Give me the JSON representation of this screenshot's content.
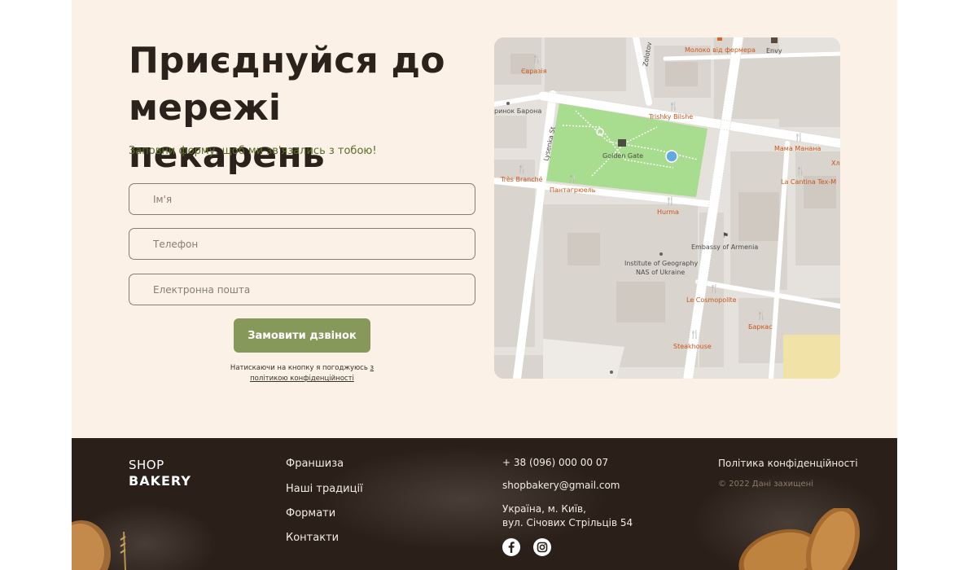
{
  "join": {
    "heading": "Приєднуйся до мережі пекарень",
    "subtitle": "Заповни форму, щоб ми зв'язались з тобою!",
    "fields": {
      "name_placeholder": "Ім'я",
      "phone_placeholder": "Телефон",
      "email_placeholder": "Електронна пошта"
    },
    "submit_label": "Замовити дзвінок",
    "consent_prefix": "Натискаючи на кнопку я погоджуюсь",
    "consent_link": "з політикою конфіденційності"
  },
  "map": {
    "streets": [
      "Zolotov",
      "Lysenka St"
    ],
    "places": [
      {
        "name": "Молоко від фермера",
        "type": "food"
      },
      {
        "name": "Envy",
        "type": "shop"
      },
      {
        "name": "Євразія",
        "type": "food"
      },
      {
        "name": "ринок Барона",
        "type": "place"
      },
      {
        "name": "Trishky Bilshe",
        "type": "food"
      },
      {
        "name": "Golden Gate",
        "type": "landmark"
      },
      {
        "name": "Мама Манана",
        "type": "food"
      },
      {
        "name": "Хл",
        "type": "food"
      },
      {
        "name": "Très Branché",
        "type": "food"
      },
      {
        "name": "Пантагрюель",
        "type": "food"
      },
      {
        "name": "La Cantina Tex-M",
        "type": "food"
      },
      {
        "name": "Hurma",
        "type": "food"
      },
      {
        "name": "Embassy of Armenia",
        "type": "embassy"
      },
      {
        "name": "Institute of Geography",
        "type": "place"
      },
      {
        "name": "NAS of Ukraine",
        "type": "place"
      },
      {
        "name": "Le Cosmopolite",
        "type": "food"
      },
      {
        "name": "Баркас",
        "type": "food"
      },
      {
        "name": "Steakhouse",
        "type": "food"
      }
    ]
  },
  "footer": {
    "logo_line1": "SHOP",
    "logo_line2": "BAKERY",
    "nav": [
      "Франшиза",
      "Наші традиції",
      "Формати",
      "Контакти"
    ],
    "phone": "+ 38 (096) 000 00 07",
    "email": "shopbakery@gmail.com",
    "address_line1": "Україна, м. Київ,",
    "address_line2": "вул. Січових Стрільців 54",
    "social": [
      "facebook-icon",
      "instagram-icon"
    ],
    "privacy": "Політика конфіденційності",
    "copyright": "© 2022 Дані захищені"
  },
  "colors": {
    "section_bg": "#fcf1e6",
    "heading": "#2b221c",
    "subtitle": "#5a6b2e",
    "button": "#87995a",
    "footer_bg": "#2a2019",
    "poi": "#d9661e",
    "park": "#a8dc8e"
  }
}
